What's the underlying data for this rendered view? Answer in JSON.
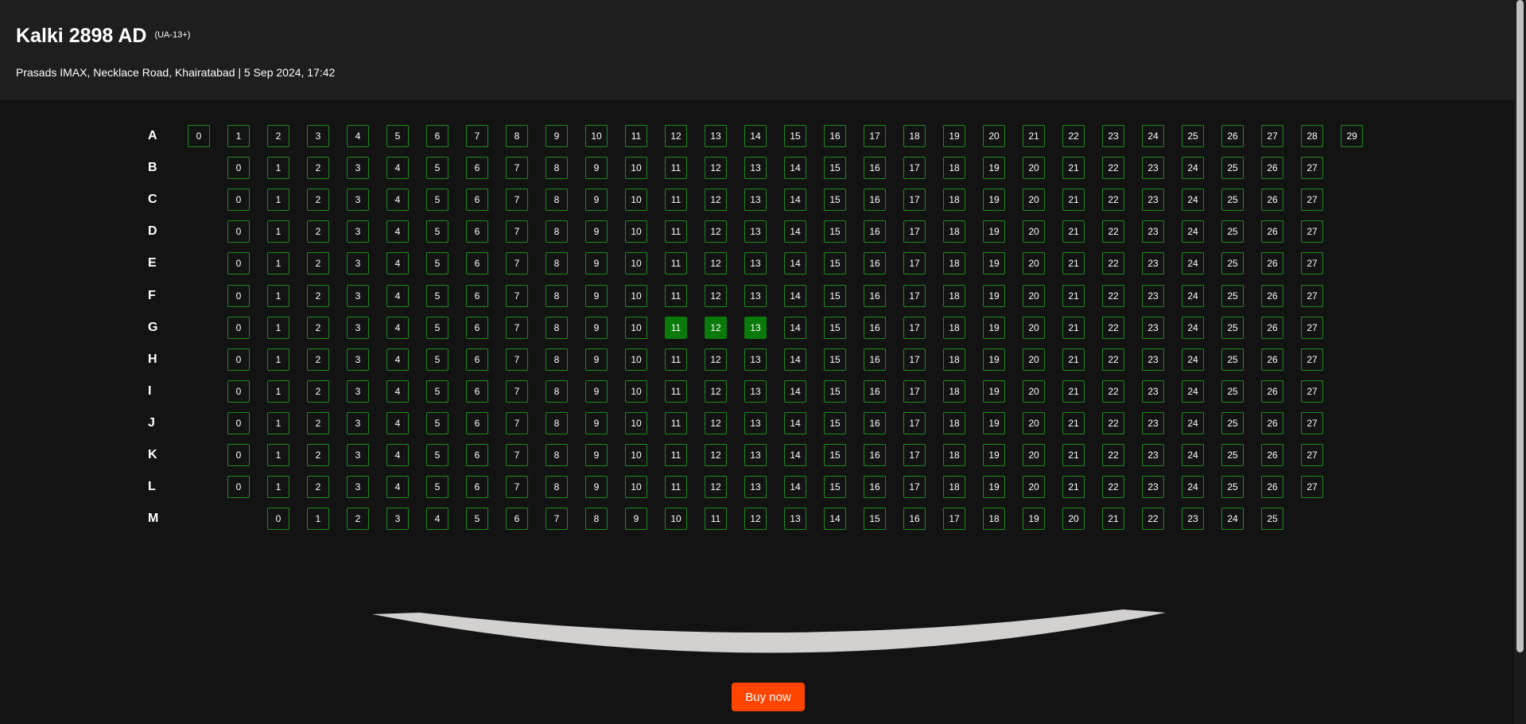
{
  "movie": {
    "title": "Kalki 2898 AD",
    "rating": "(UA-13+)",
    "venue_line": "Prasads IMAX, Necklace Road, Khairatabad | 5 Sep 2024, 17:42"
  },
  "seat_map": {
    "rows": [
      {
        "label": "A",
        "seats": [
          "0",
          "1",
          "2",
          "3",
          "4",
          "5",
          "6",
          "7",
          "8",
          "9",
          "10",
          "11",
          "12",
          "13",
          "14",
          "15",
          "16",
          "17",
          "18",
          "19",
          "20",
          "21",
          "22",
          "23",
          "24",
          "25",
          "26",
          "27",
          "28",
          "29"
        ]
      },
      {
        "label": "B",
        "seats": [
          "0",
          "1",
          "2",
          "3",
          "4",
          "5",
          "6",
          "7",
          "8",
          "9",
          "10",
          "11",
          "12",
          "13",
          "14",
          "15",
          "16",
          "17",
          "18",
          "19",
          "20",
          "21",
          "22",
          "23",
          "24",
          "25",
          "26",
          "27"
        ]
      },
      {
        "label": "C",
        "seats": [
          "0",
          "1",
          "2",
          "3",
          "4",
          "5",
          "6",
          "7",
          "8",
          "9",
          "10",
          "11",
          "12",
          "13",
          "14",
          "15",
          "16",
          "17",
          "18",
          "19",
          "20",
          "21",
          "22",
          "23",
          "24",
          "25",
          "26",
          "27"
        ]
      },
      {
        "label": "D",
        "seats": [
          "0",
          "1",
          "2",
          "3",
          "4",
          "5",
          "6",
          "7",
          "8",
          "9",
          "10",
          "11",
          "12",
          "13",
          "14",
          "15",
          "16",
          "17",
          "18",
          "19",
          "20",
          "21",
          "22",
          "23",
          "24",
          "25",
          "26",
          "27"
        ]
      },
      {
        "label": "E",
        "seats": [
          "0",
          "1",
          "2",
          "3",
          "4",
          "5",
          "6",
          "7",
          "8",
          "9",
          "10",
          "11",
          "12",
          "13",
          "14",
          "15",
          "16",
          "17",
          "18",
          "19",
          "20",
          "21",
          "22",
          "23",
          "24",
          "25",
          "26",
          "27"
        ]
      },
      {
        "label": "F",
        "seats": [
          "0",
          "1",
          "2",
          "3",
          "4",
          "5",
          "6",
          "7",
          "8",
          "9",
          "10",
          "11",
          "12",
          "13",
          "14",
          "15",
          "16",
          "17",
          "18",
          "19",
          "20",
          "21",
          "22",
          "23",
          "24",
          "25",
          "26",
          "27"
        ]
      },
      {
        "label": "G",
        "seats": [
          "0",
          "1",
          "2",
          "3",
          "4",
          "5",
          "6",
          "7",
          "8",
          "9",
          "10",
          "11",
          "12",
          "13",
          "14",
          "15",
          "16",
          "17",
          "18",
          "19",
          "20",
          "21",
          "22",
          "23",
          "24",
          "25",
          "26",
          "27"
        ],
        "selected": [
          "11",
          "12",
          "13"
        ]
      },
      {
        "label": "H",
        "seats": [
          "0",
          "1",
          "2",
          "3",
          "4",
          "5",
          "6",
          "7",
          "8",
          "9",
          "10",
          "11",
          "12",
          "13",
          "14",
          "15",
          "16",
          "17",
          "18",
          "19",
          "20",
          "21",
          "22",
          "23",
          "24",
          "25",
          "26",
          "27"
        ]
      },
      {
        "label": "I",
        "seats": [
          "0",
          "1",
          "2",
          "3",
          "4",
          "5",
          "6",
          "7",
          "8",
          "9",
          "10",
          "11",
          "12",
          "13",
          "14",
          "15",
          "16",
          "17",
          "18",
          "19",
          "20",
          "21",
          "22",
          "23",
          "24",
          "25",
          "26",
          "27"
        ]
      },
      {
        "label": "J",
        "seats": [
          "0",
          "1",
          "2",
          "3",
          "4",
          "5",
          "6",
          "7",
          "8",
          "9",
          "10",
          "11",
          "12",
          "13",
          "14",
          "15",
          "16",
          "17",
          "18",
          "19",
          "20",
          "21",
          "22",
          "23",
          "24",
          "25",
          "26",
          "27"
        ]
      },
      {
        "label": "K",
        "seats": [
          "0",
          "1",
          "2",
          "3",
          "4",
          "5",
          "6",
          "7",
          "8",
          "9",
          "10",
          "11",
          "12",
          "13",
          "14",
          "15",
          "16",
          "17",
          "18",
          "19",
          "20",
          "21",
          "22",
          "23",
          "24",
          "25",
          "26",
          "27"
        ]
      },
      {
        "label": "L",
        "seats": [
          "0",
          "1",
          "2",
          "3",
          "4",
          "5",
          "6",
          "7",
          "8",
          "9",
          "10",
          "11",
          "12",
          "13",
          "14",
          "15",
          "16",
          "17",
          "18",
          "19",
          "20",
          "21",
          "22",
          "23",
          "24",
          "25",
          "26",
          "27"
        ]
      },
      {
        "label": "M",
        "seats": [
          "0",
          "1",
          "2",
          "3",
          "4",
          "5",
          "6",
          "7",
          "8",
          "9",
          "10",
          "11",
          "12",
          "13",
          "14",
          "15",
          "16",
          "17",
          "18",
          "19",
          "20",
          "21",
          "22",
          "23",
          "24",
          "25"
        ]
      }
    ]
  },
  "colors": {
    "seat_border": "#1f8a1f",
    "seat_selected": "#0a7a0a",
    "buy_button": "#ff4500",
    "screen": "#d3d0d0"
  },
  "actions": {
    "buy_label": "Buy now"
  }
}
